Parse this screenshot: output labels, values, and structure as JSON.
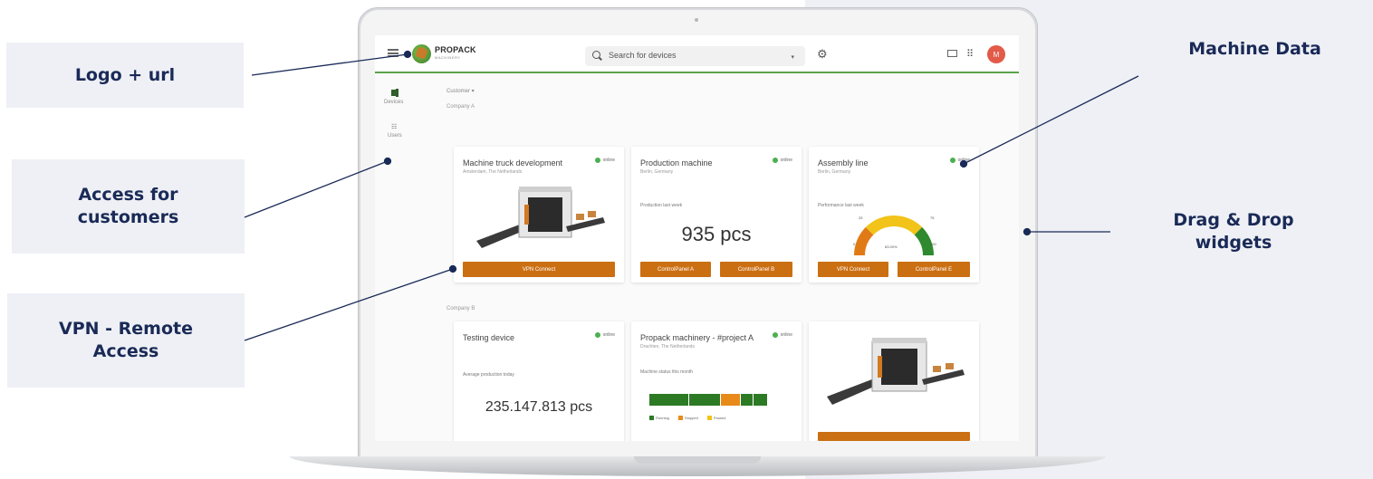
{
  "callouts": {
    "logo": "Logo + url",
    "access": "Access for customers",
    "vpn": "VPN - Remote Access",
    "machine": "Machine Data",
    "dragdrop": "Drag & Drop widgets"
  },
  "app": {
    "logo_text": "PROPACK",
    "logo_sub": "MACHINERY",
    "search_placeholder": "Search for devices",
    "avatar": "M"
  },
  "sidebar": {
    "items": [
      {
        "label": "Devices",
        "icon": "devices-icon"
      },
      {
        "label": "Users",
        "icon": "users-icon"
      }
    ]
  },
  "filter": {
    "customer": "Customer ▾"
  },
  "groups": {
    "a": "Company A",
    "b": "Company B"
  },
  "cards": {
    "c1": {
      "title": "Machine truck development",
      "subtitle": "Amsterdam, The Netherlands",
      "status": "online",
      "buttons": [
        "VPN Connect"
      ]
    },
    "c2": {
      "title": "Production machine",
      "subtitle": "Berlin, Germany",
      "status": "online",
      "metric_label": "Production last week",
      "value": "935 pcs",
      "buttons": [
        "ControlPanel A",
        "ControlPanel B"
      ]
    },
    "c3": {
      "title": "Assembly line",
      "subtitle": "Berlin, Germany",
      "status": "online",
      "metric_label": "Performance last week",
      "gauge": {
        "value_label": "83.00%",
        "value": 83,
        "min": "0",
        "max": "100",
        "t25": "25",
        "t75": "75"
      },
      "buttons": [
        "VPN Connect",
        "ControlPanel E"
      ]
    },
    "c4": {
      "title": "Testing device",
      "status": "online",
      "metric_label": "Average production today",
      "value": "235.147.813 pcs"
    },
    "c5": {
      "title": "Propack machinery - #project A",
      "subtitle": "Drachten, The Netherlands",
      "status": "online",
      "metric_label": "Machine status this month",
      "legend": [
        "Running",
        "Stopped",
        "Paused"
      ]
    }
  },
  "colors": {
    "accent": "#cb6f13",
    "brand_green": "#5aa34a",
    "navy": "#1a2a57",
    "online": "#4caf50"
  }
}
